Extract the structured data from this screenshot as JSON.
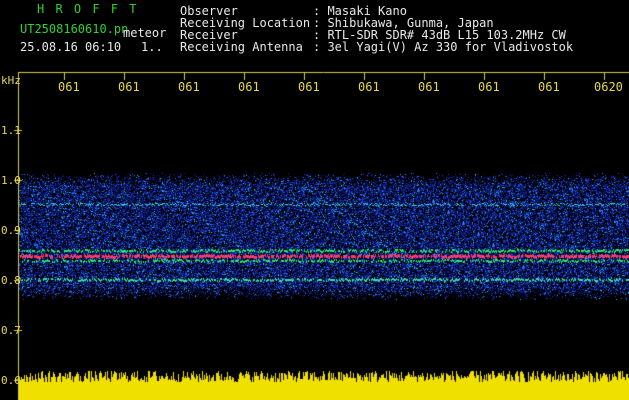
{
  "header": {
    "app_name": "H R O F F T",
    "filename": "UT2508160610.pn",
    "meteor_label": "meteor",
    "datetime": "25.08.16 06:10",
    "page_indicator": "1..",
    "fields": [
      {
        "label": "Observer",
        "value": ": Masaki Kano"
      },
      {
        "label": "Receiving Location",
        "value": ": Shibukawa, Gunma, Japan"
      },
      {
        "label": "Receiver",
        "value": ": RTL-SDR SDR# 43dB L15 103.2MHz CW"
      },
      {
        "label": "Receiving Antenna",
        "value": ": 3el Yagi(V) Az 330 for Vladivostok"
      }
    ]
  },
  "spectrogram": {
    "y_unit": "kHz",
    "y_ticks": [
      "1.1",
      "1.0",
      "0.9",
      "0.8",
      "0.7",
      "0.6"
    ],
    "x_ticks": [
      "061",
      "061",
      "061",
      "061",
      "061",
      "061",
      "061",
      "061",
      "061",
      "0620"
    ],
    "colors": {
      "label": "#e8d84a",
      "grid": "#d8d040",
      "band": "#ff3a6a",
      "signal": "#22ee66"
    }
  }
}
